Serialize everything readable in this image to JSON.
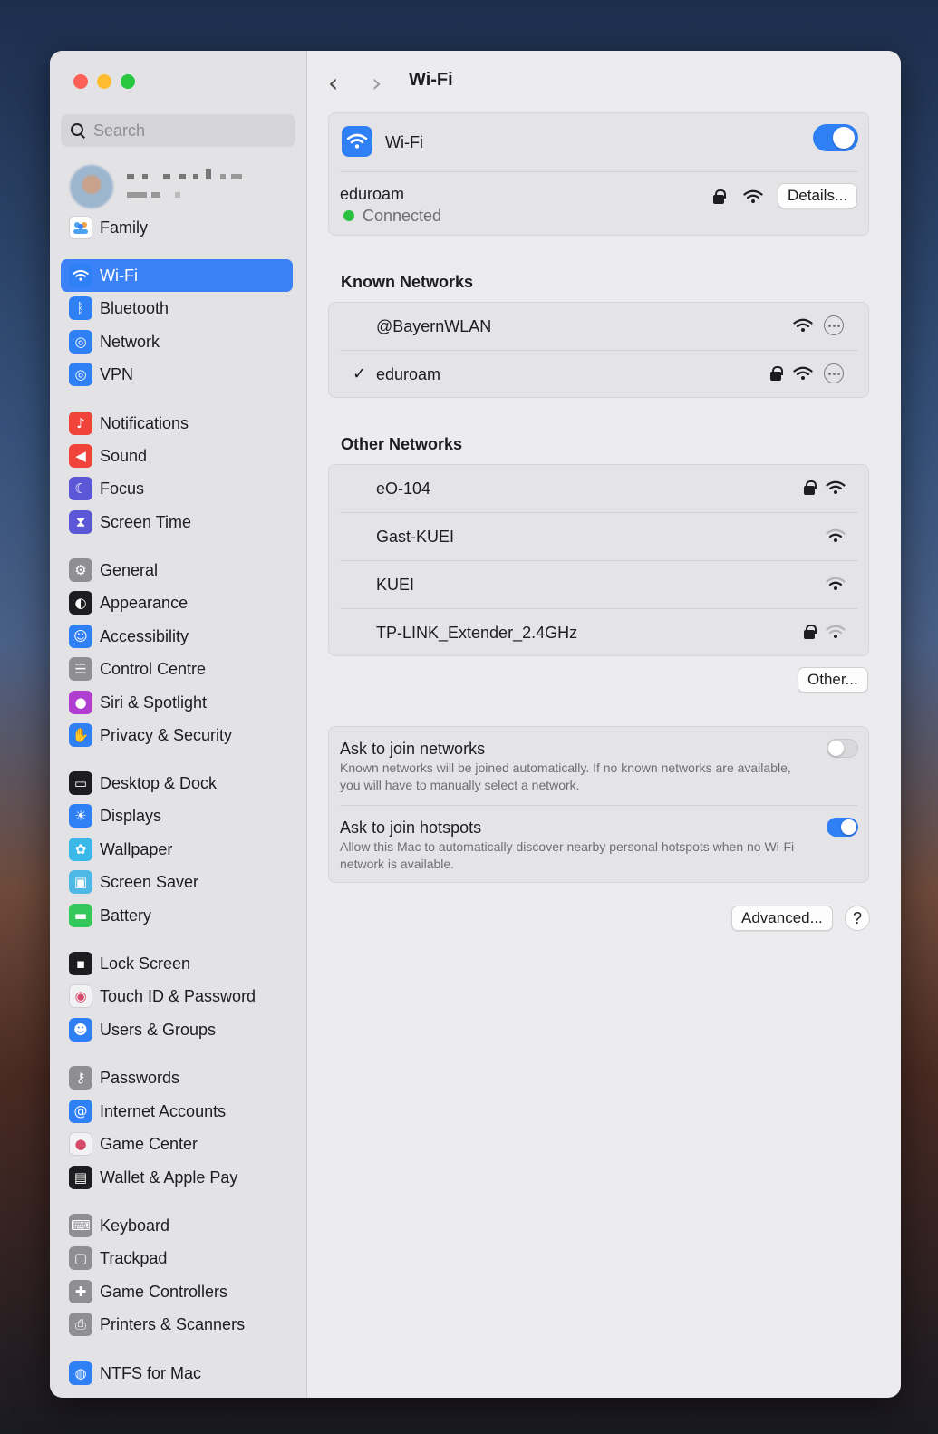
{
  "search": {
    "placeholder": "Search"
  },
  "sidebar": {
    "family_label": "Family",
    "items": [
      {
        "label": "Wi-Fi",
        "icon": "wifi-icon",
        "color": "#2f7ff5"
      },
      {
        "label": "Bluetooth",
        "icon": "bluetooth-icon",
        "color": "#2f7ff5"
      },
      {
        "label": "Network",
        "icon": "globe-icon",
        "color": "#2f7ff5"
      },
      {
        "label": "VPN",
        "icon": "vpn-globe-icon",
        "color": "#2f7ff5"
      },
      {
        "label": "Notifications",
        "icon": "bell-icon",
        "color": "#f0443a"
      },
      {
        "label": "Sound",
        "icon": "speaker-icon",
        "color": "#f0443a"
      },
      {
        "label": "Focus",
        "icon": "moon-icon",
        "color": "#5b57d6"
      },
      {
        "label": "Screen Time",
        "icon": "hourglass-icon",
        "color": "#5b57d6"
      },
      {
        "label": "General",
        "icon": "gear-icon",
        "color": "#8e8e93"
      },
      {
        "label": "Appearance",
        "icon": "appearance-icon",
        "color": "#1d1d1f"
      },
      {
        "label": "Accessibility",
        "icon": "accessibility-icon",
        "color": "#2f7ff5"
      },
      {
        "label": "Control Centre",
        "icon": "control-centre-icon",
        "color": "#8e8e93"
      },
      {
        "label": "Siri & Spotlight",
        "icon": "siri-icon",
        "color": "#b03fd0"
      },
      {
        "label": "Privacy & Security",
        "icon": "hand-icon",
        "color": "#2f7ff5"
      },
      {
        "label": "Desktop & Dock",
        "icon": "dock-icon",
        "color": "#1d1d1f"
      },
      {
        "label": "Displays",
        "icon": "sun-icon",
        "color": "#2f7ff5"
      },
      {
        "label": "Wallpaper",
        "icon": "flower-icon",
        "color": "#3ab8e8"
      },
      {
        "label": "Screen Saver",
        "icon": "screen-saver-icon",
        "color": "#4fb9e6"
      },
      {
        "label": "Battery",
        "icon": "battery-icon",
        "color": "#34c759"
      },
      {
        "label": "Lock Screen",
        "icon": "lock-screen-icon",
        "color": "#1d1d1f"
      },
      {
        "label": "Touch ID & Password",
        "icon": "fingerprint-icon",
        "color": "#f2f2f4"
      },
      {
        "label": "Users & Groups",
        "icon": "users-icon",
        "color": "#2f7ff5"
      },
      {
        "label": "Passwords",
        "icon": "key-icon",
        "color": "#8e8e93"
      },
      {
        "label": "Internet Accounts",
        "icon": "at-icon",
        "color": "#2f7ff5"
      },
      {
        "label": "Game Center",
        "icon": "game-center-icon",
        "color": "#f2f2f4"
      },
      {
        "label": "Wallet & Apple Pay",
        "icon": "wallet-icon",
        "color": "#1d1d1f"
      },
      {
        "label": "Keyboard",
        "icon": "keyboard-icon",
        "color": "#8e8e93"
      },
      {
        "label": "Trackpad",
        "icon": "trackpad-icon",
        "color": "#8e8e93"
      },
      {
        "label": "Game Controllers",
        "icon": "gamepad-icon",
        "color": "#8e8e93"
      },
      {
        "label": "Printers & Scanners",
        "icon": "printer-icon",
        "color": "#8e8e93"
      },
      {
        "label": "NTFS for Mac",
        "icon": "ntfs-icon",
        "color": "#2f7ff5"
      }
    ]
  },
  "header": {
    "title": "Wi-Fi"
  },
  "wifi_card": {
    "label": "Wi-Fi",
    "toggle_on": true,
    "current_network": "eduroam",
    "status": "Connected",
    "details_button": "Details..."
  },
  "known_networks": {
    "title": "Known Networks",
    "items": [
      {
        "name": "@BayernWLAN",
        "connected": false,
        "locked": false
      },
      {
        "name": "eduroam",
        "connected": true,
        "locked": true
      }
    ],
    "check_mark": "✓"
  },
  "other_networks": {
    "title": "Other Networks",
    "items": [
      {
        "name": "eO-104",
        "locked": true,
        "signal": "strong"
      },
      {
        "name": "Gast-KUEI",
        "locked": false,
        "signal": "medium"
      },
      {
        "name": "KUEI",
        "locked": false,
        "signal": "medium"
      },
      {
        "name": "TP-LINK_Extender_2.4GHz",
        "locked": true,
        "signal": "weak"
      }
    ],
    "other_button": "Other..."
  },
  "settings": {
    "ask_networks": {
      "title": "Ask to join networks",
      "description": "Known networks will be joined automatically. If no known networks are available, you will have to manually select a network.",
      "on": false
    },
    "ask_hotspots": {
      "title": "Ask to join hotspots",
      "description": "Allow this Mac to automatically discover nearby personal hotspots when no Wi-Fi network is available.",
      "on": true
    }
  },
  "footer": {
    "advanced_button": "Advanced...",
    "help_button": "?"
  }
}
